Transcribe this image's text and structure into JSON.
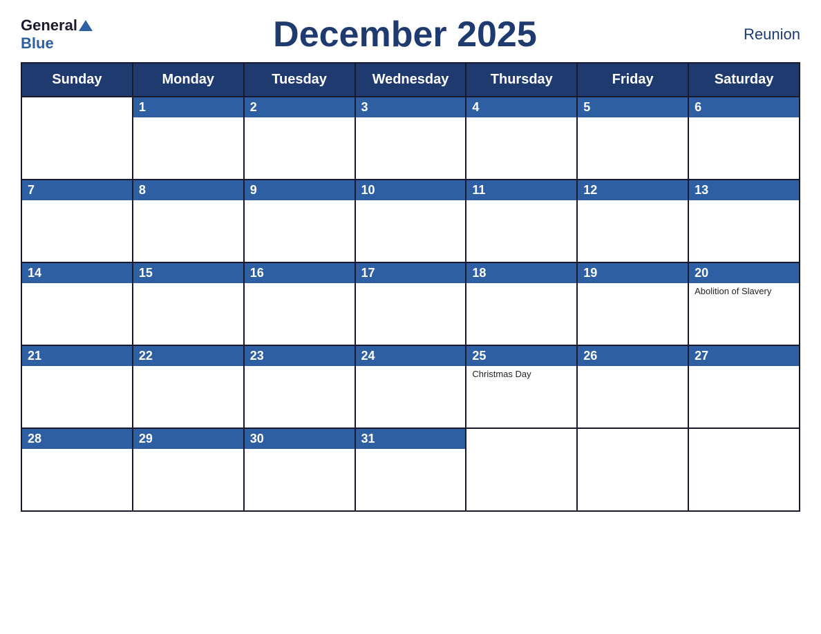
{
  "header": {
    "logo": {
      "general": "General",
      "blue": "Blue"
    },
    "title": "December 2025",
    "region": "Reunion"
  },
  "days": [
    "Sunday",
    "Monday",
    "Tuesday",
    "Wednesday",
    "Thursday",
    "Friday",
    "Saturday"
  ],
  "weeks": [
    [
      {
        "date": "",
        "event": ""
      },
      {
        "date": "1",
        "event": ""
      },
      {
        "date": "2",
        "event": ""
      },
      {
        "date": "3",
        "event": ""
      },
      {
        "date": "4",
        "event": ""
      },
      {
        "date": "5",
        "event": ""
      },
      {
        "date": "6",
        "event": ""
      }
    ],
    [
      {
        "date": "7",
        "event": ""
      },
      {
        "date": "8",
        "event": ""
      },
      {
        "date": "9",
        "event": ""
      },
      {
        "date": "10",
        "event": ""
      },
      {
        "date": "11",
        "event": ""
      },
      {
        "date": "12",
        "event": ""
      },
      {
        "date": "13",
        "event": ""
      }
    ],
    [
      {
        "date": "14",
        "event": ""
      },
      {
        "date": "15",
        "event": ""
      },
      {
        "date": "16",
        "event": ""
      },
      {
        "date": "17",
        "event": ""
      },
      {
        "date": "18",
        "event": ""
      },
      {
        "date": "19",
        "event": ""
      },
      {
        "date": "20",
        "event": "Abolition of Slavery"
      }
    ],
    [
      {
        "date": "21",
        "event": ""
      },
      {
        "date": "22",
        "event": ""
      },
      {
        "date": "23",
        "event": ""
      },
      {
        "date": "24",
        "event": ""
      },
      {
        "date": "25",
        "event": "Christmas Day"
      },
      {
        "date": "26",
        "event": ""
      },
      {
        "date": "27",
        "event": ""
      }
    ],
    [
      {
        "date": "28",
        "event": ""
      },
      {
        "date": "29",
        "event": ""
      },
      {
        "date": "30",
        "event": ""
      },
      {
        "date": "31",
        "event": ""
      },
      {
        "date": "",
        "event": ""
      },
      {
        "date": "",
        "event": ""
      },
      {
        "date": "",
        "event": ""
      }
    ]
  ]
}
